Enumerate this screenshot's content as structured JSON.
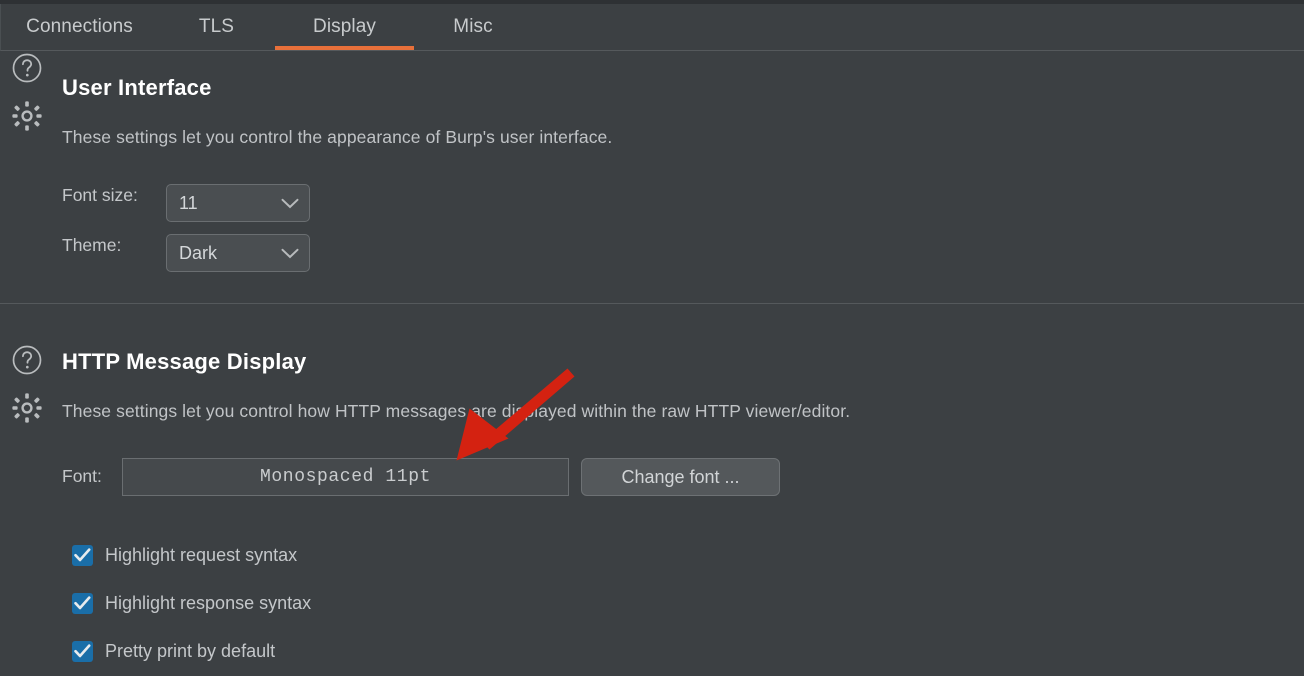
{
  "window": {
    "accent_color": "#e8703a",
    "background_color": "#3c4043",
    "checkbox_color": "#1a6ea8",
    "annotation_color": "#d42211"
  },
  "tabs": [
    {
      "label": "Connections",
      "active": false
    },
    {
      "label": "TLS",
      "active": false
    },
    {
      "label": "Display",
      "active": true
    },
    {
      "label": "Misc",
      "active": false
    }
  ],
  "sections": [
    {
      "title": "User Interface",
      "description": "These settings let you control the appearance of Burp's user interface.",
      "help_icon": "question-circle-icon",
      "settings_icon": "gear-icon",
      "fields": [
        {
          "label": "Font size:",
          "value": "11",
          "type": "dropdown"
        },
        {
          "label": "Theme:",
          "value": "Dark",
          "type": "dropdown"
        }
      ]
    },
    {
      "title": "HTTP Message Display",
      "description": "These settings let you control how HTTP messages are displayed within the raw HTTP viewer/editor.",
      "help_icon": "question-circle-icon",
      "settings_icon": "gear-icon",
      "font_row": {
        "label": "Font:",
        "value": "Monospaced 11pt",
        "button_label": "Change font ..."
      },
      "checkboxes": [
        {
          "label": "Highlight request syntax",
          "checked": true
        },
        {
          "label": "Highlight response syntax",
          "checked": true
        },
        {
          "label": "Pretty print by default",
          "checked": true
        }
      ]
    }
  ],
  "annotation": {
    "name": "red-arrow-pointing-to-font-field",
    "color": "#d42211"
  }
}
